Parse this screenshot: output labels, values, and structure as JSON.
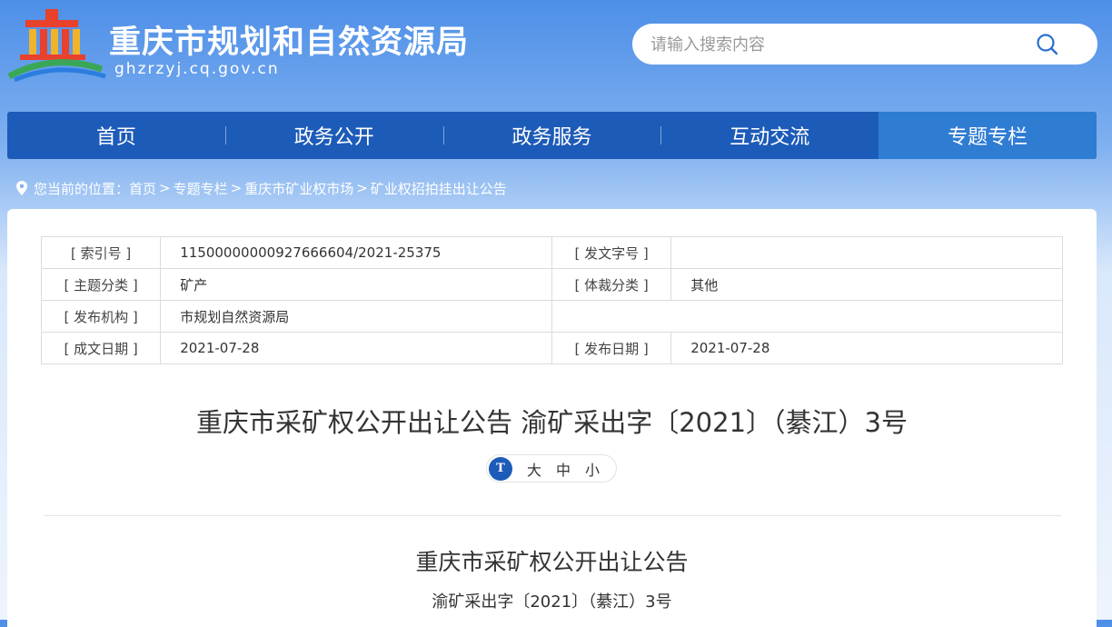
{
  "header": {
    "site_title": "重庆市规划和自然资源局",
    "site_domain": "ghzrzyj.cq.gov.cn",
    "logo_icon": "government-building-logo-icon"
  },
  "search": {
    "placeholder": "请输入搜索内容",
    "value": "",
    "icon": "search-icon"
  },
  "nav": {
    "items": [
      {
        "label": "首页"
      },
      {
        "label": "政务公开"
      },
      {
        "label": "政务服务"
      },
      {
        "label": "互动交流"
      },
      {
        "label": "专题专栏"
      }
    ],
    "active_index": 4
  },
  "breadcrumb": {
    "prefix": "您当前的位置：",
    "items": [
      "首页",
      "专题专栏",
      "重庆市矿业权市场",
      "矿业权招拍挂出让公告"
    ],
    "separator": ">"
  },
  "meta": {
    "rows": [
      {
        "l1": "[ 索引号 ]",
        "v1": "11500000000927666604/2021-25375",
        "l2": "[ 发文字号 ]",
        "v2": ""
      },
      {
        "l1": "[ 主题分类 ]",
        "v1": "矿产",
        "l2": "[ 体裁分类 ]",
        "v2": "其他"
      },
      {
        "l1": "[ 发布机构 ]",
        "v1": "市规划自然资源局"
      },
      {
        "l1": "[ 成文日期 ]",
        "v1": "2021-07-28",
        "l2": "[ 发布日期 ]",
        "v2": "2021-07-28"
      }
    ]
  },
  "document": {
    "title": "重庆市采矿权公开出让公告 渝矿采出字〔2021〕（綦江）3号",
    "font_size": {
      "icon_label": "T",
      "large": "大",
      "medium": "中",
      "small": "小"
    },
    "article_title": "重庆市采矿权公开出让公告",
    "article_subtitle": "渝矿采出字〔2021〕（綦江）3号"
  },
  "colors": {
    "nav_bg": "#1d5bb8",
    "nav_active": "#2f7cd3",
    "header_gradient_top": "#4d8fe8"
  }
}
